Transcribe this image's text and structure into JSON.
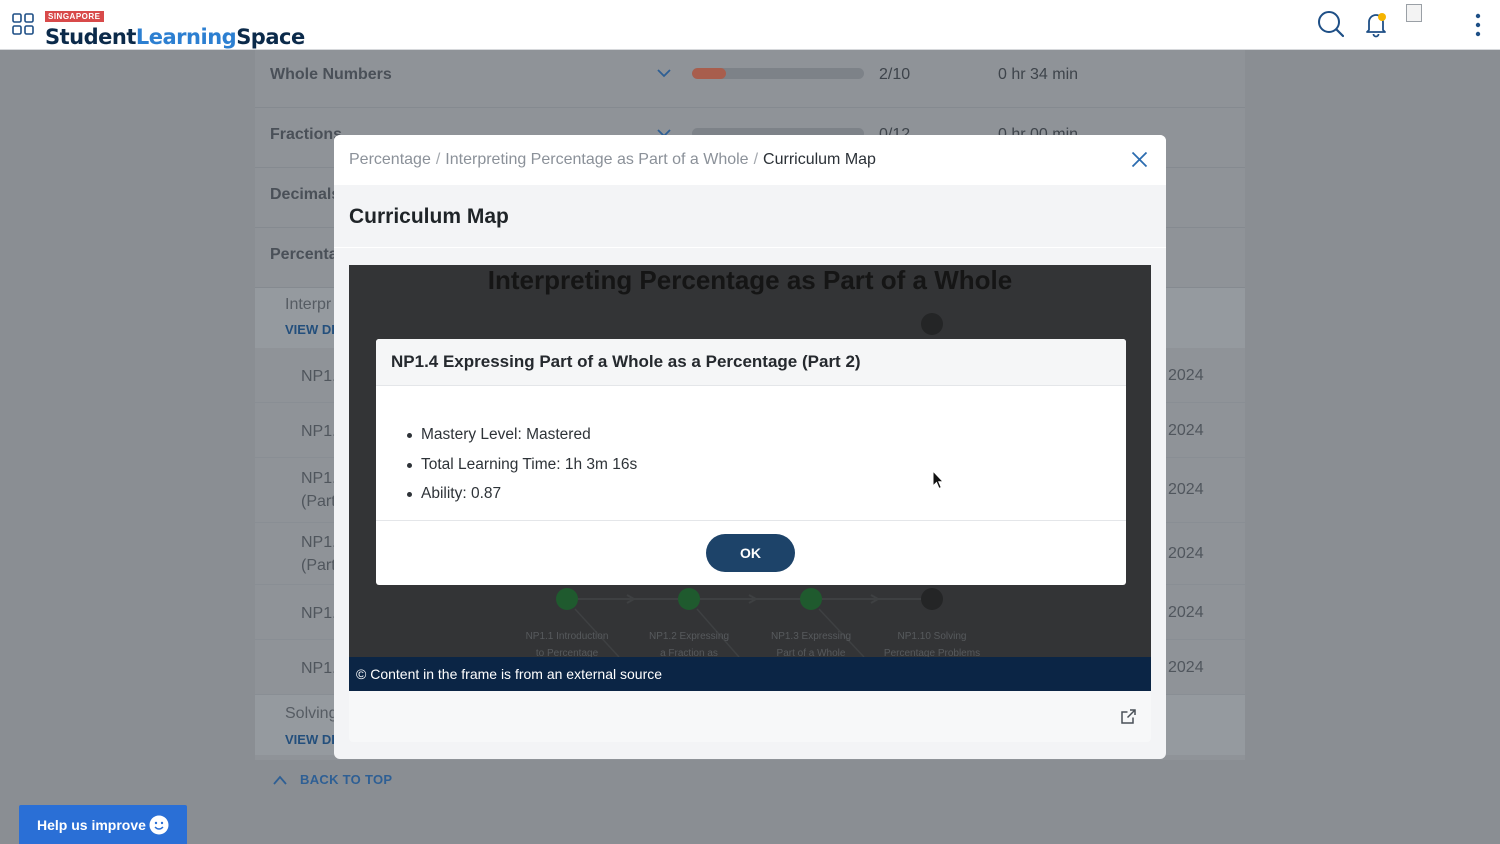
{
  "header": {
    "country_badge": "SINGAPORE",
    "brand_word1": "Student",
    "brand_word2": "Learning",
    "brand_word3": "Space",
    "icons": [
      "apps-grid-icon",
      "search-icon",
      "bell-icon",
      "avatar-icon",
      "more-vertical-icon"
    ]
  },
  "background": {
    "topics": [
      {
        "label": "Whole Numbers",
        "score": "2/10",
        "time": "0 hr 34 min",
        "progress": 0.2
      },
      {
        "label": "Fractions",
        "score": "0/12",
        "time": "0 hr 00 min"
      },
      {
        "label": "Decimals"
      },
      {
        "label": "Percenta"
      }
    ],
    "subsections": [
      {
        "title": "Interpr",
        "view": "VIEW DE"
      },
      {
        "title": "Solving",
        "view": "VIEW DE"
      }
    ],
    "items": [
      {
        "label": "NP1.",
        "date": "2024"
      },
      {
        "label": "NP1.",
        "date": "2024"
      },
      {
        "label": "NP1.",
        "label2": "(Part",
        "date": "2024"
      },
      {
        "label": "NP1.",
        "label2": "(Part",
        "date": "2024"
      },
      {
        "label": "NP1.",
        "date": "2024"
      },
      {
        "label": "NP1.",
        "date": "2024"
      }
    ],
    "back_to_top": "BACK TO TOP",
    "help_button": "Help us improve"
  },
  "modal": {
    "breadcrumb": [
      "Percentage",
      "Interpreting Percentage as Part of a Whole",
      "Curriculum Map"
    ],
    "title": "Curriculum Map",
    "frame": {
      "heading": "Interpreting Percentage as Part of a Whole",
      "nodes": [
        {
          "label_line1": "NP1.1 Introduction",
          "label_line2": "to Percentage"
        },
        {
          "label_line1": "NP1.2 Expressing",
          "label_line2": "a Fraction as"
        },
        {
          "label_line1": "NP1.3 Expressing",
          "label_line2": "Part of a Whole"
        },
        {
          "label_line1": "NP1.10 Solving",
          "label_line2": "Percentage Problems"
        }
      ]
    },
    "dialog": {
      "heading": "NP1.4 Expressing Part of a Whole as a Percentage (Part 2)",
      "details": [
        "Mastery Level: Mastered",
        "Total Learning Time: 1h 3m 16s",
        "Ability: 0.87"
      ],
      "ok_label": "OK"
    },
    "copyright": "© Content in the frame is from an external source"
  },
  "colors": {
    "brand_dark": "#0b2a4a",
    "brand_blue": "#2c7fd1",
    "button_navy": "#1d4369",
    "footer_navy": "#0b2545",
    "help_blue": "#2a6fd6",
    "mastered_green": "#1f5a2e"
  }
}
